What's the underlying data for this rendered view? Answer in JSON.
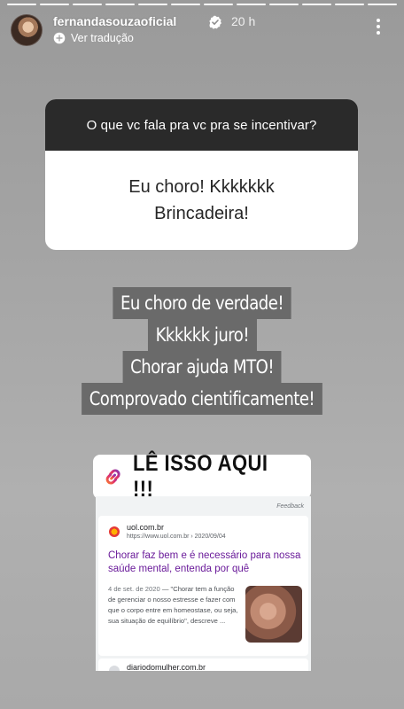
{
  "story": {
    "progress_segments": 12,
    "progress_current": 12,
    "background_color": "#a3a3a3"
  },
  "header": {
    "username": "fernandasouzaoficial",
    "verified_icon": "verified-badge-icon",
    "timestamp": "20 h",
    "translate_icon": "translate-icon",
    "translate_label": "Ver tradução",
    "more_icon": "more-vertical-icon"
  },
  "question_sticker": {
    "question": "O que vc fala pra vc pra se incentivar?",
    "answer": "Eu choro! Kkkkkkk\nBrincadeira!"
  },
  "captions": [
    "Eu choro de verdade!",
    "Kkkkkk juro!",
    "Chorar ajuda MTO!",
    "Comprovado cientificamente!"
  ],
  "link_sticker": {
    "icon": "link-icon",
    "label": "LÊ ISSO AQUI !!!"
  },
  "search_result": {
    "feedback": "Feedback",
    "site_name": "uol.com.br",
    "site_url": "https://www.uol.com.br › 2020/09/04",
    "title": "Chorar faz bem e é necessário para nossa saúde mental, entenda por quê",
    "date": "4 de set. de 2020",
    "snippet": " — \"Chorar tem a função de gerenciar o nosso estresse e fazer com que o corpo entre em homeostase, ou seja, sua situação de equilíbrio\", descreve ...",
    "next_site": "diariodomulher.com.br"
  }
}
